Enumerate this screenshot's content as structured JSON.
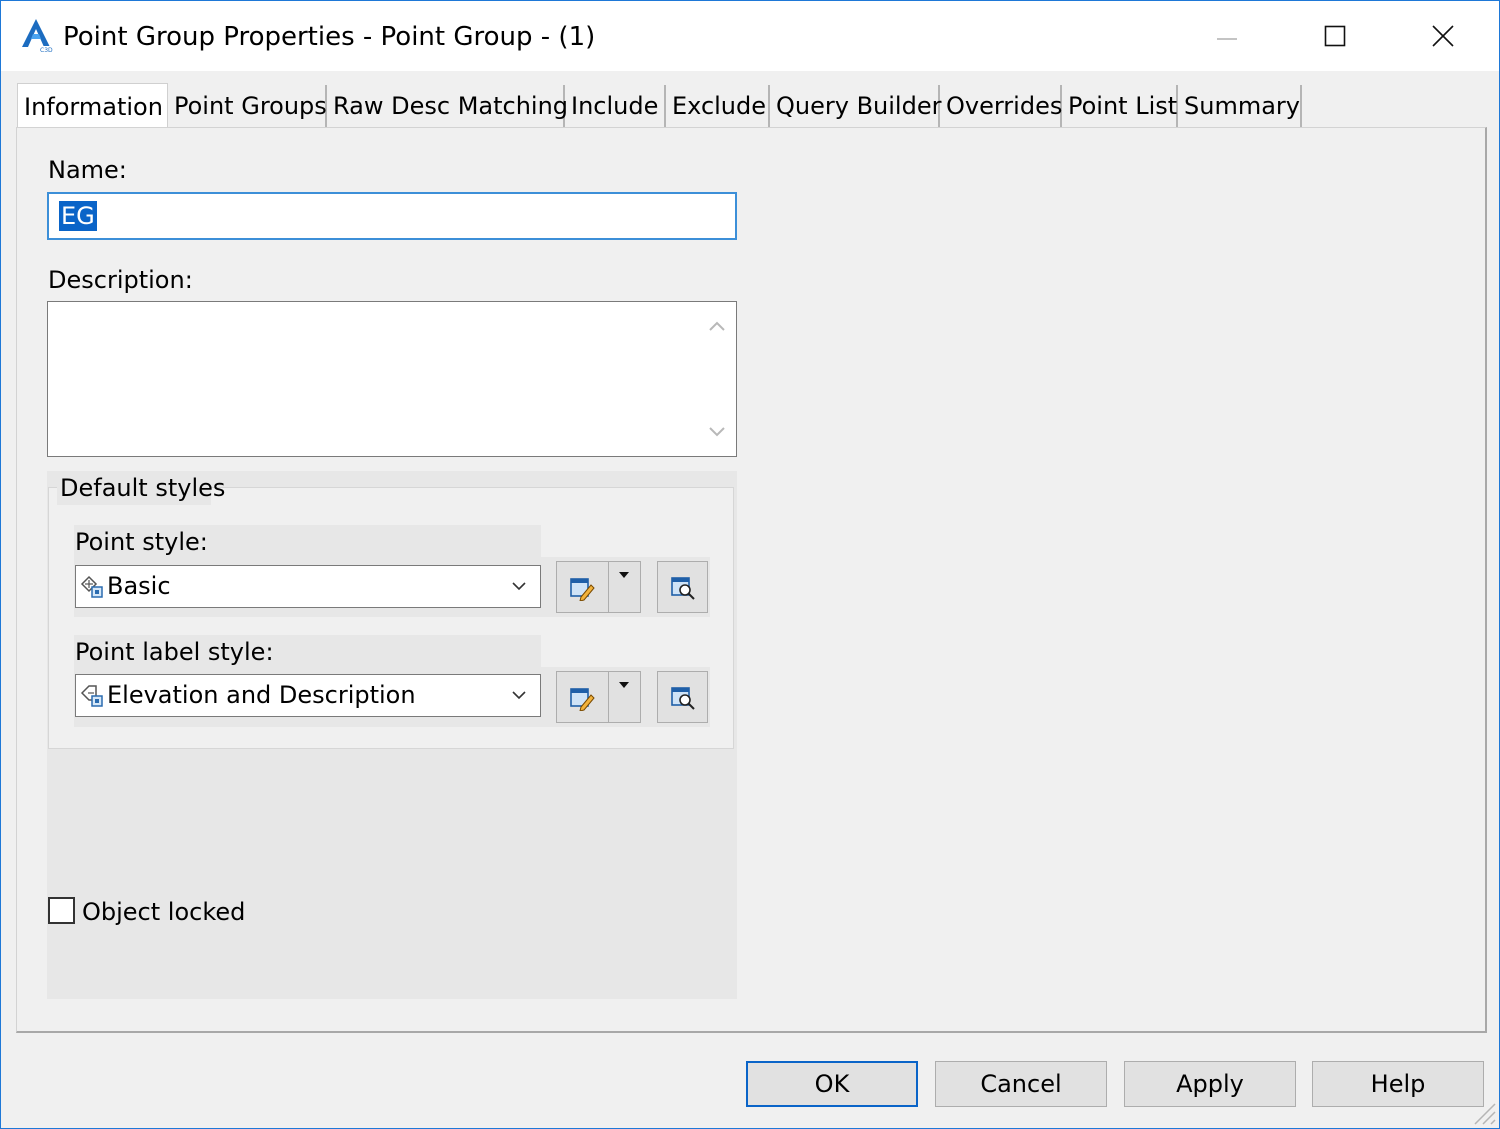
{
  "window": {
    "title": "Point Group Properties - Point Group - (1)",
    "accent_color": "#1e78d7"
  },
  "tabs": [
    {
      "label": "Information",
      "active": true
    },
    {
      "label": "Point Groups"
    },
    {
      "label": "Raw Desc Matching"
    },
    {
      "label": "Include"
    },
    {
      "label": "Exclude"
    },
    {
      "label": "Query Builder"
    },
    {
      "label": "Overrides"
    },
    {
      "label": "Point List"
    },
    {
      "label": "Summary"
    }
  ],
  "form": {
    "name_label": "Name:",
    "name_value": "EG",
    "description_label": "Description:",
    "description_value": "",
    "default_styles_label": "Default styles",
    "point_style_label": "Point style:",
    "point_style_value": "Basic",
    "point_label_style_label": "Point label style:",
    "point_label_style_value": "Elevation and Description",
    "object_locked_label": "Object locked",
    "object_locked_checked": false
  },
  "buttons": {
    "ok": "OK",
    "cancel": "Cancel",
    "apply": "Apply",
    "help": "Help"
  },
  "icons": {
    "app": "civil3d-app-icon",
    "minimize": "minimize-icon",
    "maximize": "maximize-icon",
    "close": "close-icon",
    "point_style": "point-style-icon",
    "label_style": "label-style-icon",
    "edit_style": "edit-style-icon",
    "pick_style": "pick-from-drawing-icon",
    "dropdown": "chevron-down-icon"
  }
}
